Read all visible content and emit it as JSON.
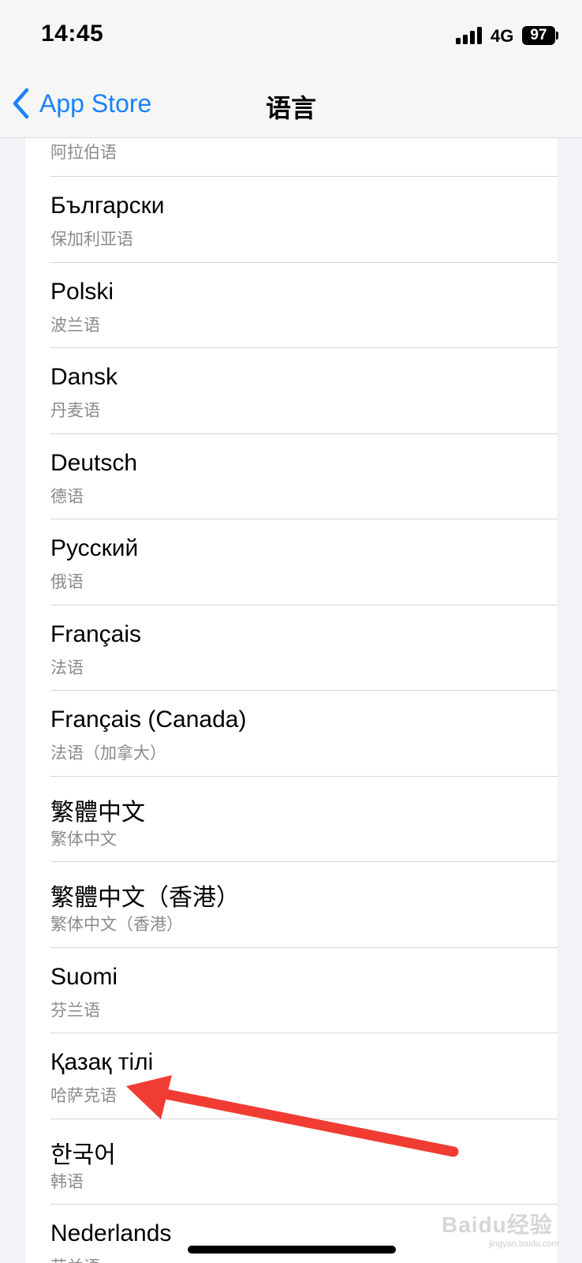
{
  "status_bar": {
    "time": "14:45",
    "network": "4G",
    "battery": "97"
  },
  "nav": {
    "back_label": "App Store",
    "title": "语言",
    "accent_color": "#1a82fb"
  },
  "list": {
    "first_partial_sub": "阿拉伯语",
    "items": [
      {
        "name": "Български",
        "sub": "保加利亚语"
      },
      {
        "name": "Polski",
        "sub": "波兰语"
      },
      {
        "name": "Dansk",
        "sub": "丹麦语"
      },
      {
        "name": "Deutsch",
        "sub": "德语"
      },
      {
        "name": "Русский",
        "sub": "俄语"
      },
      {
        "name": "Français",
        "sub": "法语"
      },
      {
        "name": "Français (Canada)",
        "sub": "法语（加拿大）"
      },
      {
        "name": "繁體中文",
        "sub": "繁体中文"
      },
      {
        "name": "繁體中文（香港）",
        "sub": "繁体中文（香港）"
      },
      {
        "name": "Suomi",
        "sub": "芬兰语"
      },
      {
        "name": "Қазақ тілі",
        "sub": "哈萨克语"
      },
      {
        "name": "한국어",
        "sub": "韩语"
      },
      {
        "name": "Nederlands",
        "sub": "荷兰语"
      }
    ]
  },
  "annotation": {
    "arrow_color": "#f03c32",
    "arrow_icon": "red-arrow-icon"
  },
  "watermark": {
    "text": "Baidu经验",
    "sub": "jingyan.baidu.com"
  }
}
